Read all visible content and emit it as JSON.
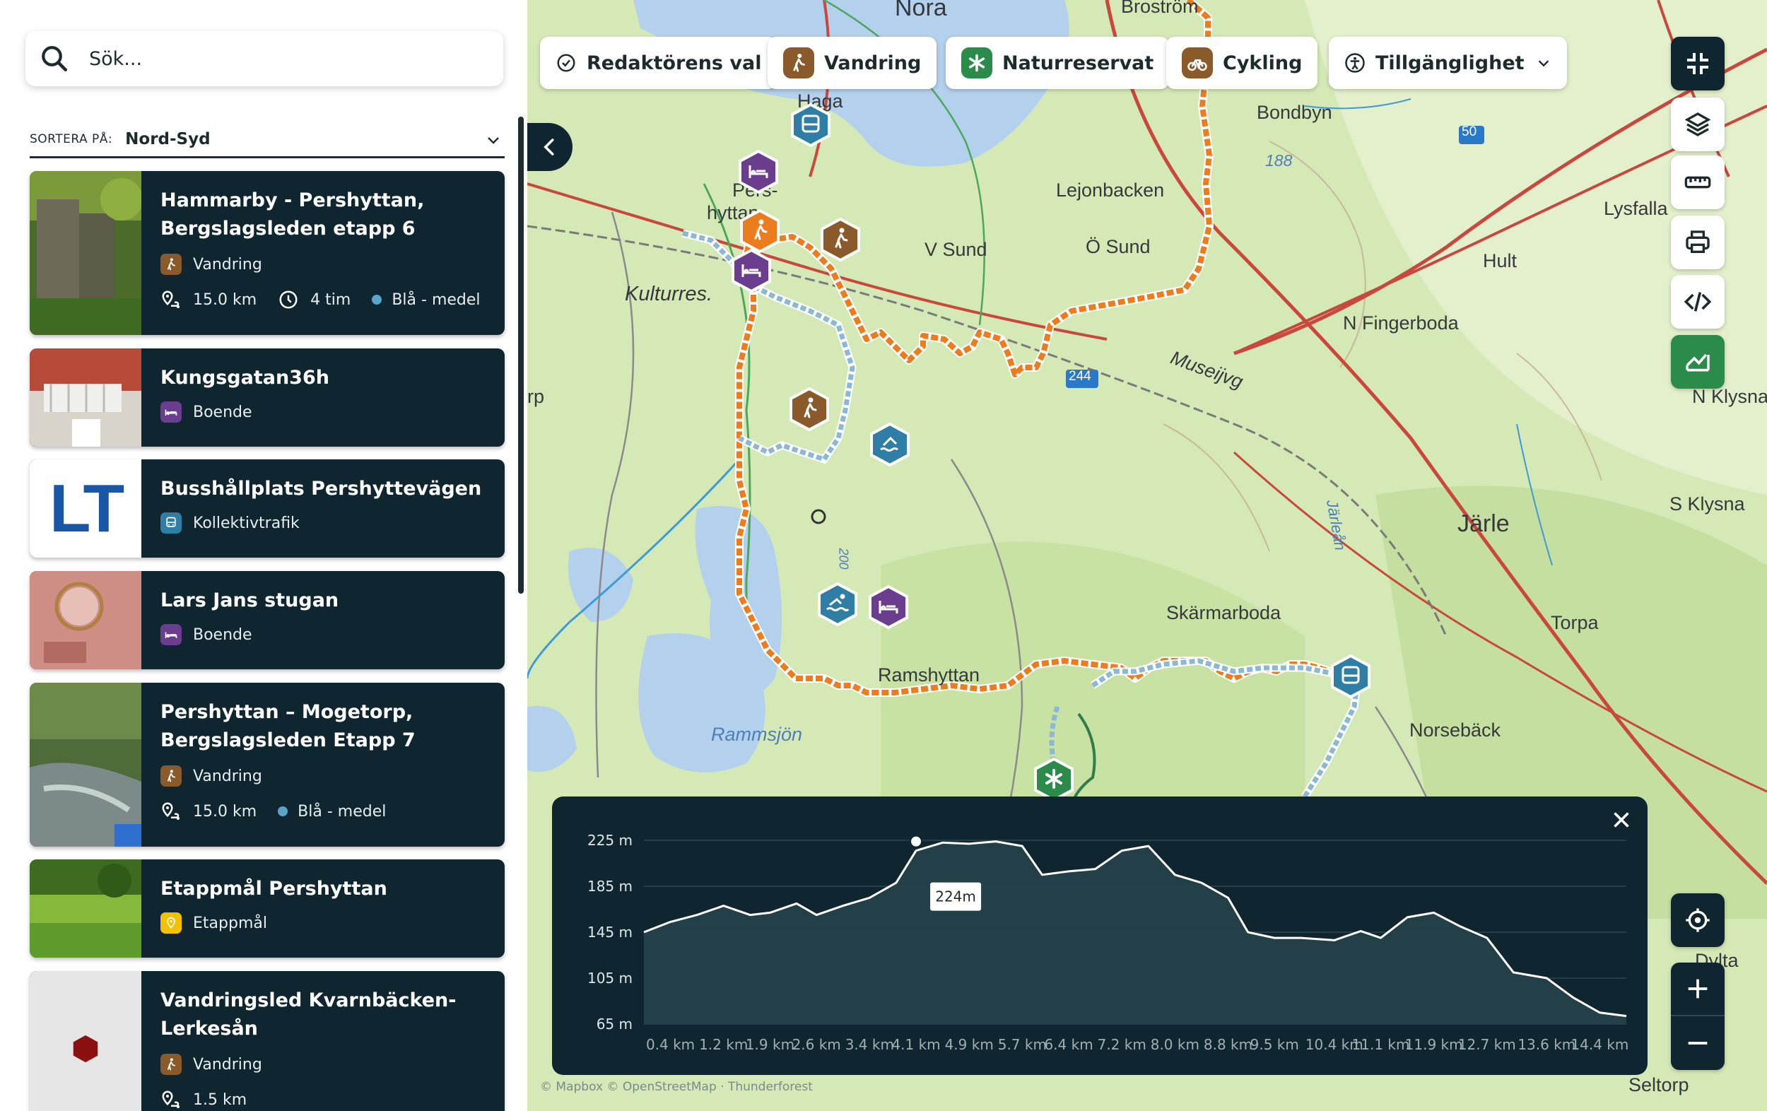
{
  "search": {
    "placeholder": "Sök..."
  },
  "sort": {
    "label": "SORTERA PÅ:",
    "value": "Nord-Syd"
  },
  "cards": [
    {
      "title": "Hammarby - Pershyttan, Bergslagsleden etapp 6",
      "category": "Vandring",
      "distance": "15.0 km",
      "duration": "4 tim",
      "difficulty": "Blå - medel",
      "category_color": "#8b5a2b"
    },
    {
      "title": "Kungsgatan36h",
      "category": "Boende",
      "category_color": "#6b3d8f"
    },
    {
      "title": "Busshållplats Pershyttevägen",
      "category": "Kollektivtrafik",
      "thumb_text": "LT",
      "category_color": "#2f7ea6"
    },
    {
      "title": "Lars Jans stugan",
      "category": "Boende",
      "category_color": "#6b3d8f"
    },
    {
      "title": "Pershyttan – Mogetorp, Bergslagsleden Etapp 7",
      "category": "Vandring",
      "distance": "15.0 km",
      "difficulty": "Blå - medel",
      "category_color": "#8b5a2b"
    },
    {
      "title": "Etappmål Pershyttan",
      "category": "Etappmål",
      "category_color": "#f2c200"
    },
    {
      "title": "Vandringsled Kvarnbäcken-Lerkesån",
      "category": "Vandring",
      "distance": "1.5 km",
      "category_color": "#8b5a2b"
    }
  ],
  "filters": [
    {
      "label": "Redaktörens val",
      "icon": "check-circle-icon"
    },
    {
      "label": "Vandring",
      "icon": "hiking-icon",
      "color": "#8b5a2b"
    },
    {
      "label": "Naturreservat",
      "icon": "nature-reserve-icon",
      "color": "#2b8b4b"
    },
    {
      "label": "Cykling",
      "icon": "bicycle-icon",
      "color": "#8b5a2b"
    },
    {
      "label": "Tillgänglighet",
      "icon": "accessibility-icon"
    }
  ],
  "map_labels": [
    "Nora",
    "Broström",
    "Haga",
    "Bondbyn",
    "Lejonbacken",
    "188",
    "50",
    "Lysfalla",
    "Hult",
    "V Sund",
    "Ö Sund",
    "Kulturres.",
    "Pers-",
    "hyttan",
    "N Fingerboda",
    "Museijvg",
    "244",
    "N Klysna",
    "S Klysna",
    "Järle",
    "Järleån",
    "Skärmarboda",
    "Torpa",
    "Rammsjön",
    "Norsebäck",
    "Ramshyttan",
    "200",
    "rp",
    "Dylta",
    "Seltorp"
  ],
  "elevation": {
    "tooltip": "224m",
    "y_ticks": [
      "225 m",
      "185 m",
      "145 m",
      "105 m",
      "65 m"
    ],
    "x_ticks": [
      "0.4 km",
      "1.2 km",
      "1.9 km",
      "2.6 km",
      "3.4 km",
      "4.1 km",
      "4.9 km",
      "5.7 km",
      "6.4 km",
      "7.2 km",
      "8.0 km",
      "8.8 km",
      "9.5 km",
      "10.4 km",
      "11.1 km",
      "11.9 km",
      "12.7 km",
      "13.6 km",
      "14.4 km"
    ]
  },
  "chart_data": {
    "type": "area",
    "x": [
      0.0,
      0.4,
      0.8,
      1.2,
      1.6,
      1.9,
      2.3,
      2.6,
      3.0,
      3.4,
      3.8,
      4.1,
      4.5,
      4.9,
      5.3,
      5.7,
      6.0,
      6.4,
      6.8,
      7.2,
      7.6,
      8.0,
      8.4,
      8.8,
      9.1,
      9.5,
      9.9,
      10.4,
      10.8,
      11.1,
      11.5,
      11.9,
      12.3,
      12.7,
      13.1,
      13.6,
      14.0,
      14.4,
      14.8
    ],
    "y": [
      145,
      154,
      160,
      168,
      160,
      162,
      170,
      160,
      168,
      175,
      188,
      216,
      223,
      222,
      224,
      220,
      195,
      198,
      200,
      216,
      220,
      195,
      188,
      175,
      145,
      140,
      140,
      138,
      146,
      140,
      158,
      162,
      150,
      140,
      110,
      105,
      88,
      75,
      72
    ],
    "xlabel": "",
    "ylabel": "",
    "ylim": [
      65,
      225
    ],
    "xlim": [
      0,
      14.8
    ],
    "grid": true,
    "marker": {
      "x": 4.1,
      "y": 224,
      "label": "224m"
    }
  },
  "attribution": "© Mapbox © OpenStreetMap · Thunderforest"
}
